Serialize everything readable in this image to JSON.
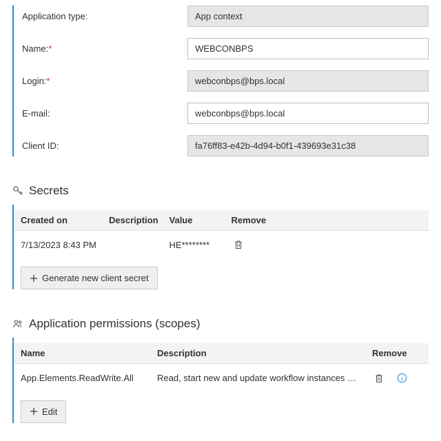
{
  "form": {
    "app_type_label": "Application type:",
    "app_type_value": "App context",
    "name_label": "Name:",
    "name_value": "WEBCONBPS",
    "login_label": "Login:",
    "login_value": "webconbps@bps.local",
    "email_label": "E-mail:",
    "email_value": "webconbps@bps.local",
    "client_id_label": "Client ID:",
    "client_id_value": "fa76ff83-e42b-4d94-b0f1-439693e31c38",
    "required_mark": "*"
  },
  "secrets": {
    "title": "Secrets",
    "headers": {
      "created": "Created on",
      "description": "Description",
      "value": "Value",
      "remove": "Remove"
    },
    "row": {
      "created": "7/13/2023 8:43 PM",
      "description": "",
      "value": "HE********"
    },
    "generate_label": "Generate new client secret"
  },
  "permissions": {
    "title": "Application permissions (scopes)",
    "headers": {
      "name": "Name",
      "description": "Description",
      "remove": "Remove"
    },
    "row": {
      "name": "App.Elements.ReadWrite.All",
      "description": "Read, start new and update workflow instances …"
    },
    "edit_label": "Edit"
  }
}
